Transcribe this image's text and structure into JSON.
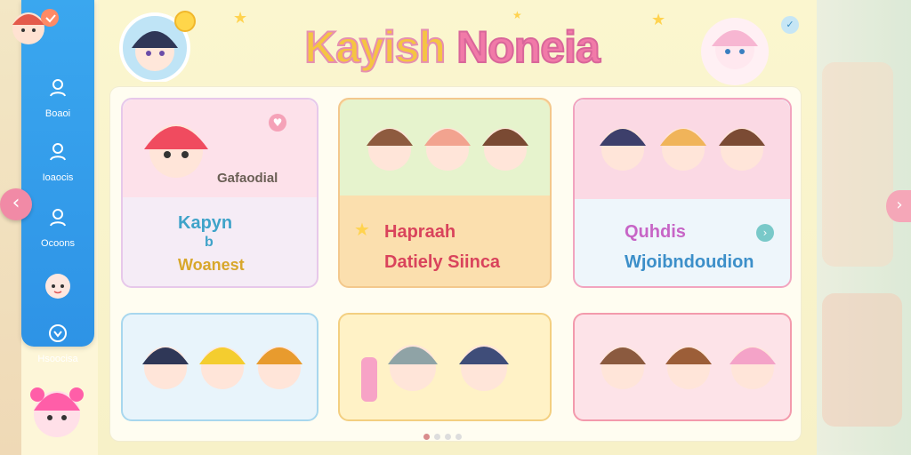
{
  "app": {
    "title_part1": "Kayish",
    "title_part2": "Noneia"
  },
  "sidebar": {
    "items": [
      {
        "label": "Boaoi",
        "icon": "person-icon"
      },
      {
        "label": "Ioaocis",
        "icon": "person-icon"
      },
      {
        "label": "Ocoons",
        "icon": "person-icon"
      },
      {
        "label": "",
        "icon": "character-face-icon"
      },
      {
        "label": "Hsoocisa",
        "icon": "heart-icon"
      }
    ]
  },
  "cards": [
    {
      "top_label": "Gafaodial",
      "bottom_line1": "Kapyn",
      "bottom_line2": "b",
      "bottom_line3": "Woanest"
    },
    {
      "row1_label": "Hapraah",
      "row2_label": "Datiely Siinca"
    },
    {
      "row1_label": "Quhdis",
      "row2_label": "Wjoibndoudion"
    },
    {},
    {},
    {}
  ],
  "colors": {
    "sidebar": "#3aa7ef",
    "accent_pink": "#f17aa8",
    "accent_yellow": "#f5c542"
  },
  "pager": {
    "active_index": 0
  }
}
